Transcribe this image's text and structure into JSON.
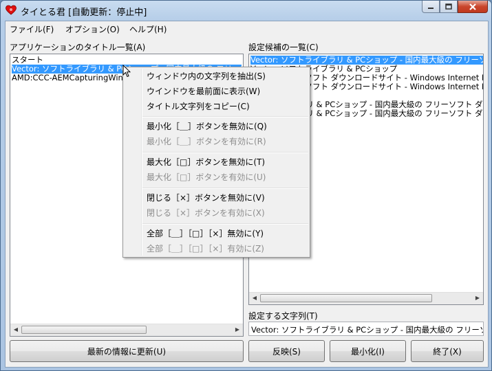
{
  "window": {
    "title": "タイとる君 [自動更新：停止中]"
  },
  "menubar": {
    "items": [
      "ファイル(F)",
      "オプション(O)",
      "ヘルプ(H)"
    ]
  },
  "left_panel": {
    "label": "アプリケーションのタイトル一覧(A)",
    "items": [
      "スタート",
      "Vector: ソフトライブラリ & PCショップ - 国内最大級の フリーソフト",
      "AMD:CCC-AEMCapturingWindow"
    ]
  },
  "right_panel": {
    "label": "設定候補の一覧(C)",
    "items": [
      "Vector: ソフトライブラリ & PCショップ - 国内最大級の フリーソフト",
      "Vector: ソフトライブラリ & PCショップ",
      "Vector: フリーソフト ダウンロードサイト - Windows Internet E",
      "Vector: フリーソフト ダウンロードサイト - Windows Internet E",
      "",
      "ソフトライブラリ & PCショップ - 国内最大級の フリーソフト ダウンロ",
      "ソフトライブラリ & PCショップ - 国内最大級の フリーソフト ダウンロ"
    ]
  },
  "setting": {
    "label": "設定する文字列(T)",
    "value": "Vector: ソフトライブラリ & PCショップ - 国内最大級の フリーソフト"
  },
  "buttons": {
    "refresh": "最新の情報に更新(U)",
    "apply": "反映(S)",
    "minimize": "最小化(I)",
    "exit": "終了(X)"
  },
  "context_menu": {
    "items": [
      {
        "label": "ウィンドウ内の文字列を抽出(S)",
        "enabled": true
      },
      {
        "label": "ウインドウを最前面に表示(W)",
        "enabled": true
      },
      {
        "label": "タイトル文字列をコピー(C)",
        "enabled": true
      },
      {
        "label": "最小化［＿］ボタンを無効に(Q)",
        "enabled": true
      },
      {
        "label": "最小化［＿］ボタンを有効に(R)",
        "enabled": false
      },
      {
        "label": "最大化［□］ボタンを無効に(T)",
        "enabled": true
      },
      {
        "label": "最大化［□］ボタンを有効に(U)",
        "enabled": false
      },
      {
        "label": "閉じる［×］ボタンを無効に(V)",
        "enabled": true
      },
      {
        "label": "閉じる［×］ボタンを有効に(X)",
        "enabled": false
      },
      {
        "label": "全部［＿］［□］［×］無効に(Y)",
        "enabled": true
      },
      {
        "label": "全部［＿］［□］［×］有効に(Z)",
        "enabled": false
      }
    ]
  },
  "colors": {
    "selection": "#3399ff",
    "close_button": "#c9462c"
  }
}
